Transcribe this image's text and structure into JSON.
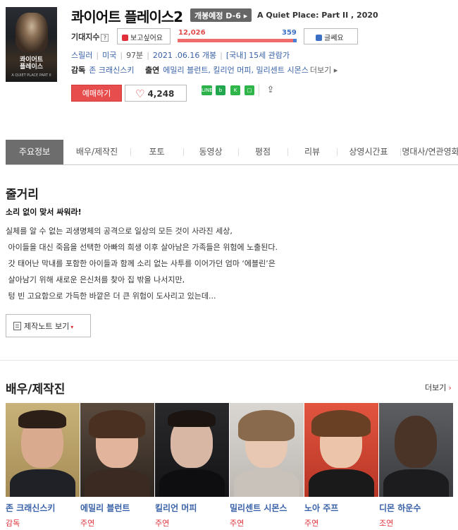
{
  "movie": {
    "poster_title": "콰이어트\n플레이스",
    "poster_subtitle": "A QUIET PLACE PART II",
    "title": "콰이어트 플레이스2",
    "release_badge": "개봉예정 D-6 ▸",
    "english_title": "A Quiet Place: Part II , 2020",
    "anticipation_label": "기대지수",
    "anticipation_help": "?",
    "want_label": "보고싶어요",
    "want_count": "12,026",
    "not_want_count": "359",
    "want_ratio": 0.971,
    "not_want_label": "글쎄요",
    "genre": "스릴러",
    "country": "미국",
    "runtime": "97분",
    "release_date": "2021 .06.16 개봉",
    "rating": "[국내] 15세 관람가",
    "director_label": "감독",
    "director": "존 크래신스키",
    "cast_label": "출연",
    "cast_list": "에밀리 블런트, 킬리언 머피, 밀리센트 시몬스",
    "more_label": "더보기 ▸",
    "book_label": "예매하기",
    "like_count": "4,248",
    "share_icons": [
      "line-icon",
      "band-icon",
      "kakao-icon",
      "copy-link-icon",
      "share-icon"
    ]
  },
  "tabs": [
    {
      "label": "주요정보",
      "active": true
    },
    {
      "label": "배우/제작진",
      "active": false
    },
    {
      "label": "포토",
      "active": false
    },
    {
      "label": "동영상",
      "active": false
    },
    {
      "label": "평점",
      "active": false
    },
    {
      "label": "리뷰",
      "active": false
    },
    {
      "label": "상영시간표",
      "active": false
    },
    {
      "label": "명대사/연관영화",
      "active": false
    }
  ],
  "synopsis": {
    "heading": "줄거리",
    "headline": "소리 없이 맞서 싸워라!",
    "body": "실체를 알 수 없는 괴생명체의 공격으로 일상의 모든 것이 사라진 세상,\n 아이들을 대신 죽음을 선택한 아빠의 희생 이후 살아남은 가족들은 위험에 노출된다.\n 갓 태어난 막내를 포함한 아이들과 함께 소리 없는 사투를 이어가던 엄마 ‘에블린’은\n 살아남기 위해 새로운 은신처를 찾아 집 밖을 나서지만,\n 텅 빈 고요함으로 가득한 바깥은 더 큰 위험이 도사리고 있는데...",
    "note_button": "제작노트 보기",
    "note_caret": "▾"
  },
  "cast_section": {
    "heading": "배우/제작진",
    "more_label": "더보기",
    "more_arrow": "›",
    "people": [
      {
        "name": "존 크래신스키",
        "role": "감독"
      },
      {
        "name": "에밀리 블런트",
        "role": "주연"
      },
      {
        "name": "킬리언 머피",
        "role": "주연"
      },
      {
        "name": "밀리센트 시몬스",
        "role": "주연"
      },
      {
        "name": "노아 주프",
        "role": "주연"
      },
      {
        "name": "디몬 하운수",
        "role": "조연"
      }
    ]
  },
  "colors": {
    "accent_red": "#e84d4d",
    "link_blue": "#3a62a8",
    "active_tab": "#6d6d6d",
    "not_want_blue": "#4a7fd8"
  }
}
